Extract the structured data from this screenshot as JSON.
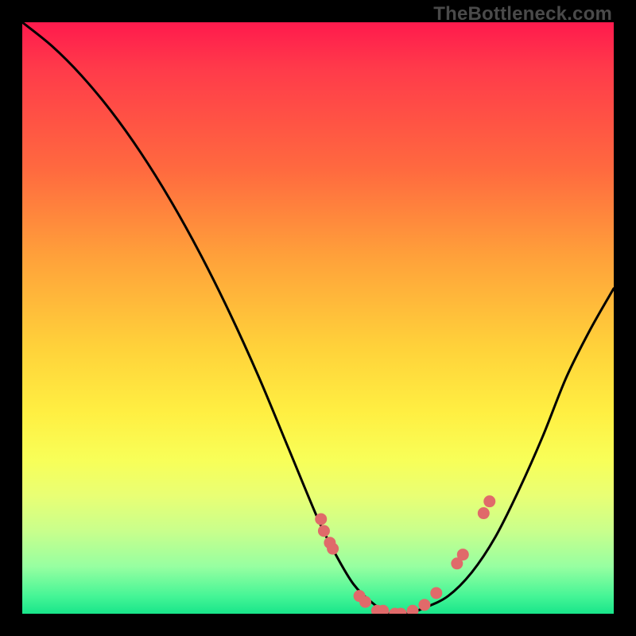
{
  "watermark": "TheBottleneck.com",
  "chart_data": {
    "type": "line",
    "title": "",
    "xlabel": "",
    "ylabel": "",
    "xlim": [
      0,
      100
    ],
    "ylim": [
      0,
      100
    ],
    "series": [
      {
        "name": "curve",
        "x": [
          0,
          5,
          10,
          15,
          20,
          25,
          30,
          35,
          40,
          45,
          50,
          53,
          56,
          59,
          62,
          65,
          68,
          72,
          76,
          80,
          84,
          88,
          92,
          96,
          100
        ],
        "y": [
          100,
          96,
          91,
          85,
          78,
          70,
          61,
          51,
          40,
          28,
          16,
          10,
          5,
          2,
          0,
          0,
          1,
          3,
          7,
          13,
          21,
          30,
          40,
          48,
          55
        ]
      }
    ],
    "points": {
      "name": "markers",
      "color": "#e06a6a",
      "x": [
        50.5,
        51.0,
        52.0,
        52.5,
        57,
        58,
        60,
        61,
        63,
        64,
        66,
        68,
        70,
        73.5,
        74.5,
        78,
        79
      ],
      "y": [
        16,
        14,
        12,
        11,
        3,
        2,
        0.5,
        0.5,
        0,
        0,
        0.5,
        1.5,
        3.5,
        8.5,
        10,
        17,
        19
      ]
    }
  }
}
